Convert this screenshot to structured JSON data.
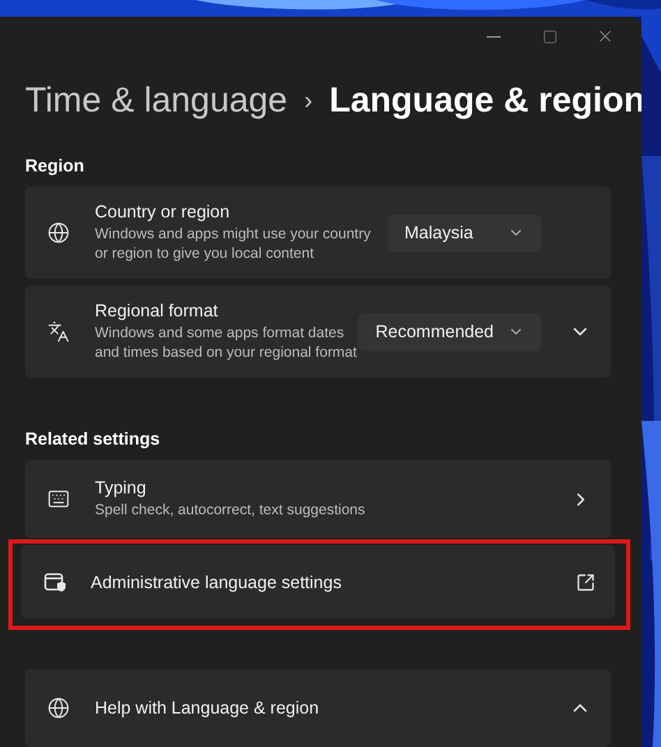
{
  "breadcrumb": {
    "parent": "Time & language",
    "separator": "›",
    "current": "Language & region"
  },
  "sections": [
    {
      "heading": "Region",
      "items": [
        {
          "kind": "dropdown",
          "title": "Country or region",
          "description": "Windows and apps might use your country or region to give you local content",
          "value": "Malaysia"
        },
        {
          "kind": "expander",
          "title": "Regional format",
          "description": "Windows and some apps format dates and times based on your regional format",
          "value": "Recommended",
          "expanded": false
        }
      ]
    },
    {
      "heading": "Related settings",
      "items": [
        {
          "kind": "link",
          "title": "Typing",
          "description": "Spell check, autocorrect, text suggestions"
        },
        {
          "kind": "external",
          "title": "Administrative language settings",
          "highlighted": true
        }
      ]
    }
  ],
  "help": {
    "title": "Help with Language & region",
    "expanded": true
  }
}
